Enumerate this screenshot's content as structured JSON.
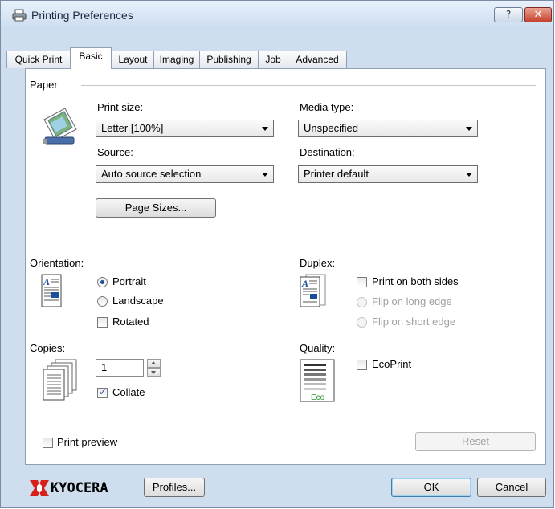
{
  "window": {
    "title": "Printing Preferences",
    "help_label": "?",
    "close_label": "✕"
  },
  "tabs": [
    {
      "label": "Quick Print"
    },
    {
      "label": "Basic"
    },
    {
      "label": "Layout"
    },
    {
      "label": "Imaging"
    },
    {
      "label": "Publishing"
    },
    {
      "label": "Job"
    },
    {
      "label": "Advanced"
    }
  ],
  "active_tab": "Basic",
  "paper": {
    "section_label": "Paper",
    "print_size": {
      "label": "Print size:",
      "value": "Letter  [100%]"
    },
    "media_type": {
      "label": "Media type:",
      "value": "Unspecified"
    },
    "source": {
      "label": "Source:",
      "value": "Auto source selection"
    },
    "destination": {
      "label": "Destination:",
      "value": "Printer default"
    },
    "page_sizes_button": "Page Sizes..."
  },
  "orientation": {
    "label": "Orientation:",
    "portrait": "Portrait",
    "landscape": "Landscape",
    "rotated": "Rotated",
    "selected": "Portrait",
    "rotated_checked": false
  },
  "duplex": {
    "label": "Duplex:",
    "print_both_sides": "Print on both sides",
    "flip_long": "Flip on long edge",
    "flip_short": "Flip on short edge",
    "both_sides_checked": false
  },
  "copies": {
    "label": "Copies:",
    "value": "1",
    "collate": "Collate",
    "collate_checked": true
  },
  "quality": {
    "label": "Quality:",
    "ecoprint": "EcoPrint",
    "eco_badge": "Eco",
    "ecoprint_checked": false
  },
  "print_preview": {
    "label": "Print preview",
    "checked": false
  },
  "reset_button": "Reset",
  "footer": {
    "brand": "KYOCERA",
    "profiles_button": "Profiles...",
    "ok_button": "OK",
    "cancel_button": "Cancel"
  },
  "colors": {
    "frame": "#cfdeef",
    "brand_red": "#d6211b",
    "accent_blue": "#1b4f9a"
  }
}
